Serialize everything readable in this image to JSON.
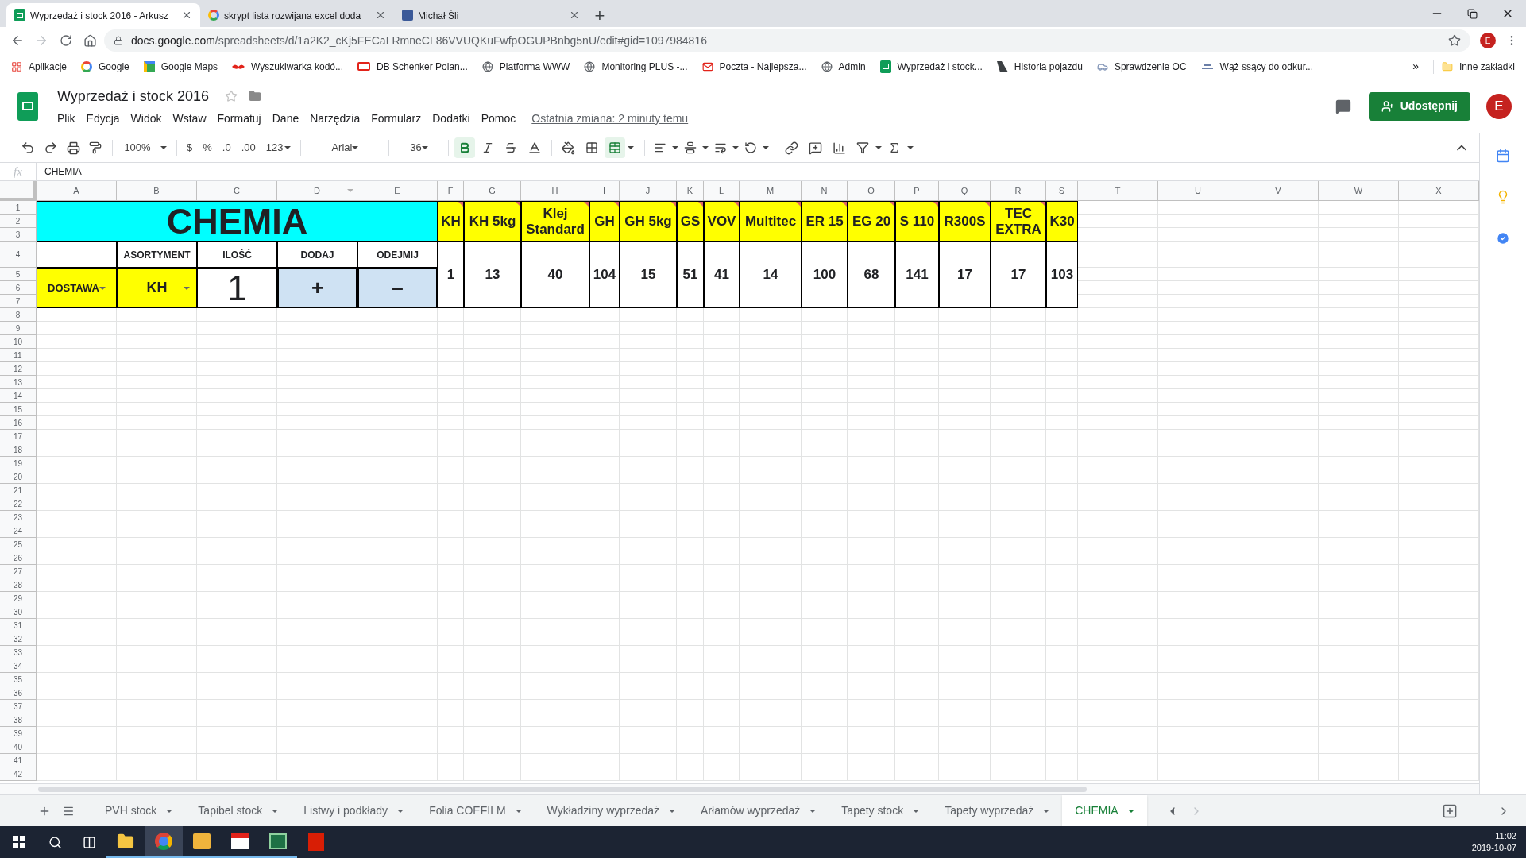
{
  "browser": {
    "tabs": [
      {
        "title": "Wyprzedaż i stock 2016 - Arkusz",
        "selected": true,
        "kind": "sheets"
      },
      {
        "title": "skrypt lista rozwijana excel doda",
        "selected": false,
        "kind": "google"
      },
      {
        "title": "Michał Śli",
        "selected": false,
        "kind": "facebook"
      }
    ],
    "new_tab": "+",
    "url_host": "docs.google.com",
    "url_path": "/spreadsheets/d/1a2K2_cKj5FECaLRmneCL86VVUQKuFwfpOGUPBnbg5nU/edit#gid=1097984816",
    "profile": "E",
    "bookmarks": [
      {
        "label": "Aplikacje",
        "kind": "apps"
      },
      {
        "label": "Google",
        "kind": "google"
      },
      {
        "label": "Google Maps",
        "kind": "maps"
      },
      {
        "label": "Wyszukiwarka kodó...",
        "kind": "bird"
      },
      {
        "label": "DB Schenker Polan...",
        "kind": "db"
      },
      {
        "label": "Platforma WWW",
        "kind": "globe"
      },
      {
        "label": "Monitoring PLUS -...",
        "kind": "globe"
      },
      {
        "label": "Poczta - Najlepsza...",
        "kind": "mail"
      },
      {
        "label": "Admin",
        "kind": "globe"
      },
      {
        "label": "Wyprzedaż i stock...",
        "kind": "sheets"
      },
      {
        "label": "Historia pojazdu",
        "kind": "road"
      },
      {
        "label": "Sprawdzenie OC",
        "kind": "car"
      },
      {
        "label": "Wąż ssący do odkur...",
        "kind": "hose"
      }
    ],
    "more": "»",
    "other_bookmarks": "Inne zakładki"
  },
  "doc": {
    "title": "Wyprzedaż i stock 2016",
    "menu": [
      "Plik",
      "Edycja",
      "Widok",
      "Wstaw",
      "Formatuj",
      "Dane",
      "Narzędzia",
      "Formularz",
      "Dodatki",
      "Pomoc"
    ],
    "last_edit": "Ostatnia zmiana: 2 minuty temu",
    "share": "Udostępnij",
    "avatar": "E"
  },
  "toolbar": {
    "zoom": "100%",
    "currency": "$",
    "percent": "%",
    "decimal_less": ".0",
    "decimal_more": ".00",
    "number_format": "123",
    "font": "Arial",
    "font_size": "36",
    "bold_active": true,
    "merge_active": true
  },
  "formula_bar": {
    "label": "fx",
    "value": "CHEMIA"
  },
  "sheet": {
    "columns": [
      "A",
      "B",
      "C",
      "D",
      "E",
      "F",
      "G",
      "H",
      "I",
      "J",
      "K",
      "L",
      "M",
      "N",
      "O",
      "P",
      "Q",
      "R",
      "S",
      "T",
      "U",
      "V",
      "W",
      "X"
    ],
    "rows": [
      "1",
      "2",
      "3",
      "4",
      "5",
      "6",
      "7",
      "8",
      "9",
      "10",
      "11",
      "12",
      "13",
      "14",
      "15",
      "16",
      "17",
      "18",
      "19",
      "20",
      "21",
      "22",
      "23",
      "24",
      "25",
      "26",
      "27",
      "28",
      "29",
      "30",
      "31",
      "32",
      "33",
      "34",
      "35",
      "36",
      "37",
      "38",
      "39",
      "40",
      "41",
      "42"
    ],
    "title_cell": "CHEMIA",
    "form_headers": [
      "ASORTYMENT",
      "ILOŚĆ",
      "DODAJ",
      "ODEJMIJ"
    ],
    "type_dropdown": "DOSTAWA",
    "product_dropdown": "KH",
    "quantity": "1",
    "add_button": "+",
    "subtract_button": "–",
    "products": [
      {
        "name": "KH",
        "stock": "1",
        "has_note": true
      },
      {
        "name": "KH 5kg",
        "stock": "13",
        "has_note": true
      },
      {
        "name": "Klej Standard",
        "stock": "40",
        "has_note": true
      },
      {
        "name": "GH",
        "stock": "104",
        "has_note": true
      },
      {
        "name": "GH 5kg",
        "stock": "15",
        "has_note": true
      },
      {
        "name": "GS",
        "stock": "51",
        "has_note": true
      },
      {
        "name": "VOV",
        "stock": "41",
        "has_note": true
      },
      {
        "name": "Multitec",
        "stock": "14",
        "has_note": true
      },
      {
        "name": "ER 15",
        "stock": "100",
        "has_note": true
      },
      {
        "name": "EG 20",
        "stock": "68",
        "has_note": true
      },
      {
        "name": "S 110",
        "stock": "141",
        "has_note": true
      },
      {
        "name": "R300S",
        "stock": "17",
        "has_note": true
      },
      {
        "name": "TEC EXTRA",
        "stock": "17",
        "has_note": true
      },
      {
        "name": "K30",
        "stock": "103",
        "has_note": false
      }
    ]
  },
  "sheet_tabs": [
    {
      "label": "PVH stock",
      "selected": false
    },
    {
      "label": "Tapibel stock",
      "selected": false
    },
    {
      "label": "Listwy i podkłady",
      "selected": false
    },
    {
      "label": "Folia COEFILM",
      "selected": false
    },
    {
      "label": "Wykładziny wyprzedaż",
      "selected": false
    },
    {
      "label": "Arłamów wyprzedaż",
      "selected": false
    },
    {
      "label": "Tapety stock",
      "selected": false
    },
    {
      "label": "Tapety wyprzedaż",
      "selected": false
    },
    {
      "label": "CHEMIA",
      "selected": true
    }
  ],
  "taskbar": {
    "time": "11:02",
    "date": "2019-10-07"
  }
}
